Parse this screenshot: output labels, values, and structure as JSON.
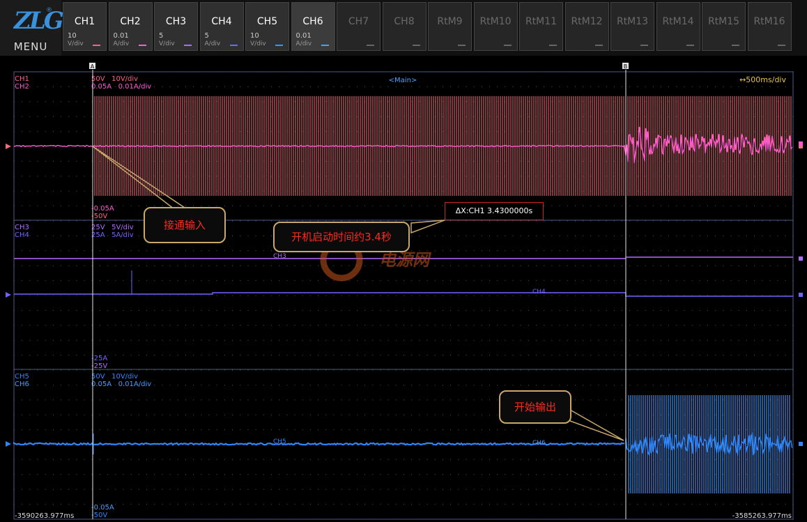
{
  "app": {
    "logo_text": "ZLG",
    "logo_reg": "®",
    "menu_label": "MENU"
  },
  "channels": [
    {
      "name": "CH1",
      "scale": "10",
      "unit": "V/div",
      "color": "#ff5f8f",
      "enabled": true
    },
    {
      "name": "CH2",
      "scale": "0.01",
      "unit": "A/div",
      "color": "#ff60d0",
      "enabled": true
    },
    {
      "name": "CH3",
      "scale": "5",
      "unit": "V/div",
      "color": "#a070ff",
      "enabled": true
    },
    {
      "name": "CH4",
      "scale": "5",
      "unit": "A/div",
      "color": "#6a6aff",
      "enabled": true
    },
    {
      "name": "CH5",
      "scale": "10",
      "unit": "V/div",
      "color": "#3399ff",
      "enabled": true
    },
    {
      "name": "CH6",
      "scale": "0.01",
      "unit": "A/div",
      "color": "#33aaff",
      "enabled": true,
      "active": true
    },
    {
      "name": "CH7",
      "enabled": false
    },
    {
      "name": "CH8",
      "enabled": false
    },
    {
      "name": "RtM9",
      "enabled": false
    },
    {
      "name": "RtM10",
      "enabled": false
    },
    {
      "name": "RtM11",
      "enabled": false
    },
    {
      "name": "RtM12",
      "enabled": false
    },
    {
      "name": "RtM13",
      "enabled": false
    },
    {
      "name": "RtM14",
      "enabled": false
    },
    {
      "name": "RtM15",
      "enabled": false
    },
    {
      "name": "RtM16",
      "enabled": false
    }
  ],
  "scope": {
    "view_label": "<Main>",
    "timebase": "↔500ms/div",
    "cursor_a_label": "A",
    "cursor_b_label": "B",
    "time_left": "-3590263.977ms",
    "time_right": "-3585263.977ms",
    "measure": "ΔX:CH1 3.4300000s",
    "watermark": "电源网",
    "colors": {
      "ch1": "#f06f78",
      "ch2": "#ff5ad2",
      "ch3": "#b26bff",
      "ch4": "#7064ff",
      "ch5": "#2f87ff",
      "ch6": "#4a9bff",
      "grid": "#3a3a3a",
      "cursor": "#e6e6e6"
    }
  },
  "panels": [
    {
      "name_a": "CH1",
      "name_b": "CH2",
      "scale_a": "50V   10V/div",
      "scale_b": "0.05A   0.01A/div",
      "min_a": "-0.05A",
      "min_b": "-50V",
      "trace_label": ""
    },
    {
      "name_a": "CH3",
      "name_b": "CH4",
      "scale_a": "25V   5V/div",
      "scale_b": "25A   5A/div",
      "min_a": "-25A",
      "min_b": "-25V",
      "trace_label_a": "CH3",
      "trace_label_b": "CH4"
    },
    {
      "name_a": "CH5",
      "name_b": "CH6",
      "scale_a": "50V   10V/div",
      "scale_b": "0.05A   0.01A/div",
      "min_a": "-0.05A",
      "min_b": "-50V",
      "trace_label_a": "CH5",
      "trace_label_b": "CH6"
    }
  ],
  "annotations": {
    "input_on": "接通输入",
    "startup_time": "开机启动时间约3.4秒",
    "output_start": "开始输出"
  }
}
